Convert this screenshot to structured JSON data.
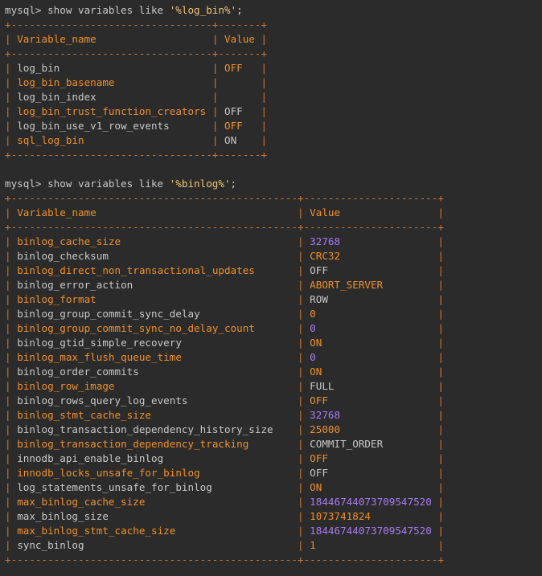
{
  "colors": {
    "background": "#2b2b2b",
    "orange": "#f0902a",
    "gray": "#c8c8c8",
    "purple": "#a77bf3",
    "border": "#cc7832"
  },
  "query1": {
    "prompt": "mysql> show variables like ",
    "pattern": "'%log_bin%'",
    "terminator": ";",
    "border": "+---------------------------------+-------+",
    "header": {
      "name": "Variable_name",
      "value": "Value"
    },
    "rows": [
      {
        "name": "log_bin",
        "value": "OFF",
        "name_color": "gray",
        "value_color": "orange"
      },
      {
        "name": "log_bin_basename",
        "value": "",
        "name_color": "orange",
        "value_color": "gray"
      },
      {
        "name": "log_bin_index",
        "value": "",
        "name_color": "gray",
        "value_color": "gray"
      },
      {
        "name": "log_bin_trust_function_creators",
        "value": "OFF",
        "name_color": "orange",
        "value_color": "gray"
      },
      {
        "name": "log_bin_use_v1_row_events",
        "value": "OFF",
        "name_color": "gray",
        "value_color": "orange"
      },
      {
        "name": "sql_log_bin",
        "value": "ON",
        "name_color": "orange",
        "value_color": "gray"
      }
    ]
  },
  "query2": {
    "prompt": "mysql> show variables like ",
    "pattern": "'%binlog%'",
    "terminator": ";",
    "border": "+-----------------------------------------------+----------------------+",
    "header": {
      "name": "Variable_name",
      "value": "Value"
    },
    "rows": [
      {
        "name": "binlog_cache_size",
        "value": "32768",
        "name_color": "orange",
        "value_color": "purple"
      },
      {
        "name": "binlog_checksum",
        "value": "CRC32",
        "name_color": "gray",
        "value_color": "orange"
      },
      {
        "name": "binlog_direct_non_transactional_updates",
        "value": "OFF",
        "name_color": "orange",
        "value_color": "gray"
      },
      {
        "name": "binlog_error_action",
        "value": "ABORT_SERVER",
        "name_color": "gray",
        "value_color": "orange"
      },
      {
        "name": "binlog_format",
        "value": "ROW",
        "name_color": "orange",
        "value_color": "gray"
      },
      {
        "name": "binlog_group_commit_sync_delay",
        "value": "0",
        "name_color": "gray",
        "value_color": "orange"
      },
      {
        "name": "binlog_group_commit_sync_no_delay_count",
        "value": "0",
        "name_color": "orange",
        "value_color": "purple"
      },
      {
        "name": "binlog_gtid_simple_recovery",
        "value": "ON",
        "name_color": "gray",
        "value_color": "orange"
      },
      {
        "name": "binlog_max_flush_queue_time",
        "value": "0",
        "name_color": "orange",
        "value_color": "purple"
      },
      {
        "name": "binlog_order_commits",
        "value": "ON",
        "name_color": "gray",
        "value_color": "orange"
      },
      {
        "name": "binlog_row_image",
        "value": "FULL",
        "name_color": "orange",
        "value_color": "gray"
      },
      {
        "name": "binlog_rows_query_log_events",
        "value": "OFF",
        "name_color": "gray",
        "value_color": "orange"
      },
      {
        "name": "binlog_stmt_cache_size",
        "value": "32768",
        "name_color": "orange",
        "value_color": "purple"
      },
      {
        "name": "binlog_transaction_dependency_history_size",
        "value": "25000",
        "name_color": "gray",
        "value_color": "orange"
      },
      {
        "name": "binlog_transaction_dependency_tracking",
        "value": "COMMIT_ORDER",
        "name_color": "orange",
        "value_color": "gray"
      },
      {
        "name": "innodb_api_enable_binlog",
        "value": "OFF",
        "name_color": "gray",
        "value_color": "orange"
      },
      {
        "name": "innodb_locks_unsafe_for_binlog",
        "value": "OFF",
        "name_color": "orange",
        "value_color": "gray"
      },
      {
        "name": "log_statements_unsafe_for_binlog",
        "value": "ON",
        "name_color": "gray",
        "value_color": "orange"
      },
      {
        "name": "max_binlog_cache_size",
        "value": "18446744073709547520",
        "name_color": "orange",
        "value_color": "purple"
      },
      {
        "name": "max_binlog_size",
        "value": "1073741824",
        "name_color": "gray",
        "value_color": "orange"
      },
      {
        "name": "max_binlog_stmt_cache_size",
        "value": "18446744073709547520",
        "name_color": "orange",
        "value_color": "purple"
      },
      {
        "name": "sync_binlog",
        "value": "1",
        "name_color": "gray",
        "value_color": "orange"
      }
    ]
  }
}
